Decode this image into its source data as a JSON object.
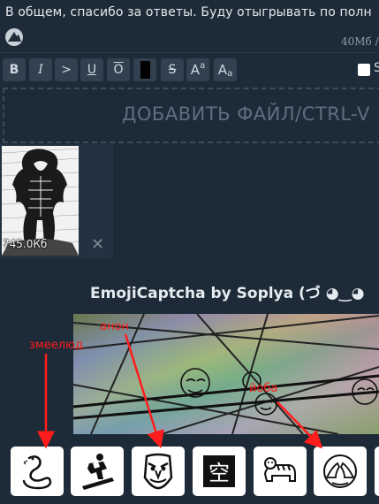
{
  "message": {
    "text": "В общем, спасибо за ответы. Буду отыгрывать по полн",
    "file_size": "40Мб / 4"
  },
  "toolbar": {
    "bold": "B",
    "italic": "I",
    "quote": ">",
    "underline": "U",
    "overline": "O",
    "spoiler": "",
    "strike": "S",
    "sup_big": "A",
    "sup_small": "a",
    "sub_big": "A",
    "sub_small": "a",
    "sage_label": "S"
  },
  "dropzone": {
    "label": "ДОБАВИТЬ ФАЙЛ/CTRL-V"
  },
  "attachment": {
    "size": "745.0Кб",
    "remove": "✕"
  },
  "captcha": {
    "title": "EmojiCaptcha by Soplya (づ ◕‿◕",
    "annotations": {
      "snake_label": "змеелюд",
      "anon_label": "анон",
      "yoba_label": "йоба"
    },
    "options": [
      "snake-emoji",
      "snowboarder-emoji",
      "tengu-mask-emoji",
      "kanji-empty-emoji",
      "tiger-emoji",
      "palms-up-emoji"
    ],
    "kanji": "空"
  },
  "colors": {
    "background": "#1d2b38",
    "button": "#314150",
    "annotation": "#ff1c1c"
  }
}
